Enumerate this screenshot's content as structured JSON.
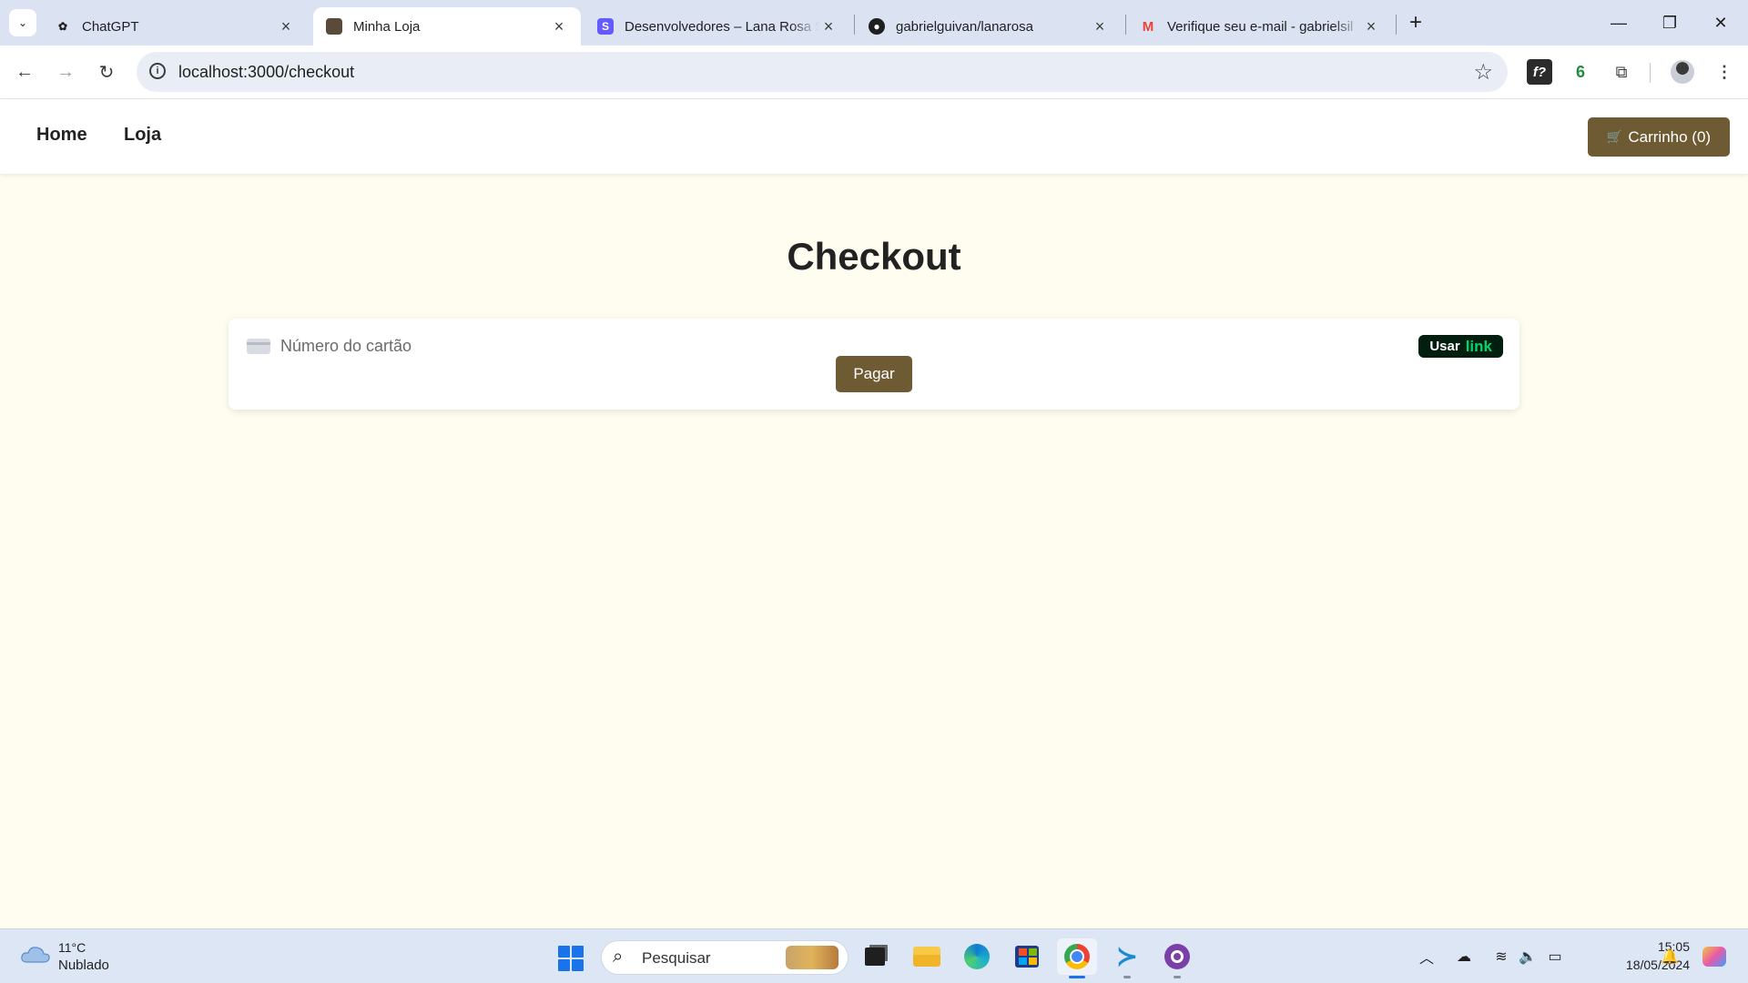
{
  "browser": {
    "tabs": [
      {
        "title": "ChatGPT",
        "icon": "chatgpt-icon",
        "active": false
      },
      {
        "title": "Minha Loja",
        "icon": "store-favicon",
        "active": true
      },
      {
        "title": "Desenvolvedores – Lana Rosa S",
        "icon": "stripe-icon",
        "active": false
      },
      {
        "title": "gabrielguivan/lanarosa",
        "icon": "github-icon",
        "active": false
      },
      {
        "title": "Verifique seu e-mail - gabrielsil",
        "icon": "gmail-icon",
        "active": false
      }
    ],
    "new_tab": "+",
    "url": "localhost:3000/checkout",
    "extensions": [
      "fx-extension-icon",
      "six-extension-icon",
      "puzzle-extension-icon"
    ],
    "extension_labels": {
      "fx": "f?",
      "six": "6"
    }
  },
  "site": {
    "nav": {
      "home": "Home",
      "shop": "Loja"
    },
    "cart_label": "Carrinho (0)",
    "page_title": "Checkout",
    "card_placeholder": "Número do cartão",
    "link_use": "Usar",
    "link_word": "link",
    "pay_label": "Pagar",
    "colors": {
      "accent": "#6f5b33",
      "background": "#fefdf0",
      "link_green": "#00d66f",
      "link_bg": "#011e0f"
    }
  },
  "taskbar": {
    "weather_temp": "11°C",
    "weather_desc": "Nublado",
    "search_placeholder": "Pesquisar",
    "apps": [
      "task-view-icon",
      "file-explorer-icon",
      "edge-icon",
      "store-icon",
      "chrome-icon",
      "vscode-icon",
      "github-desktop-icon"
    ],
    "time": "15:05",
    "date": "18/05/2024"
  }
}
